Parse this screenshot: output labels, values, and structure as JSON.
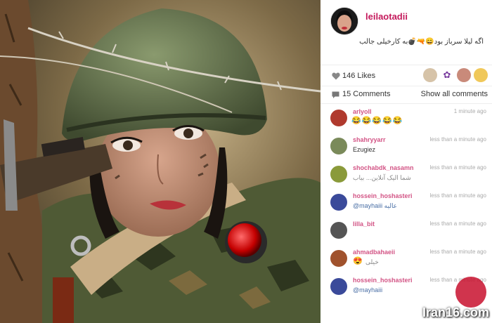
{
  "post": {
    "username": "leilaotadii",
    "caption": "اگه لیلا سرباز بود😄🔫💣به کارخیلی جالب"
  },
  "likes": {
    "label": "146 Likes"
  },
  "comments_header": {
    "label": "15 Comments",
    "show_all": "Show all comments"
  },
  "comments": [
    {
      "user": "arlyoll",
      "time": "1 minute ago",
      "text": "",
      "emoji": "😂😂😂😂😂",
      "avatar_color": "#b03a2e"
    },
    {
      "user": "shahryyarr",
      "time": "less than a minute ago",
      "text": "Ezugiez",
      "emoji": "",
      "avatar_color": "#7a8a5a"
    },
    {
      "user": "shochabdk_nasamn",
      "time": "less than a minute ago",
      "text": "شما الیک آنلاین...\nبیاب",
      "emoji": "",
      "avatar_color": "#8a9a3a"
    },
    {
      "user": "hossein_hoshasteri",
      "time": "less than a minute ago",
      "text": "@mayhaiii عالیه",
      "emoji": "",
      "avatar_color": "#3a4a9a"
    },
    {
      "user": "lilla_bit",
      "time": "less than a minute ago",
      "text": "",
      "emoji": "",
      "avatar_color": "#555555"
    },
    {
      "user": "ahmadbahaeii",
      "time": "less than a minute ago",
      "text": "خیلی",
      "emoji": "😍",
      "avatar_color": "#a0522d"
    },
    {
      "user": "hossein_hoshasteri",
      "time": "less than a minute ago",
      "text": "@mayhaiii",
      "emoji": "",
      "avatar_color": "#3a4a9a"
    }
  ],
  "watermark": {
    "text": "Iran16.com"
  },
  "colors": {
    "username": "#c41a5c",
    "accent": "#c41a5c"
  },
  "icons": {
    "likes": "heart-icon",
    "comments": "comment-icon"
  }
}
